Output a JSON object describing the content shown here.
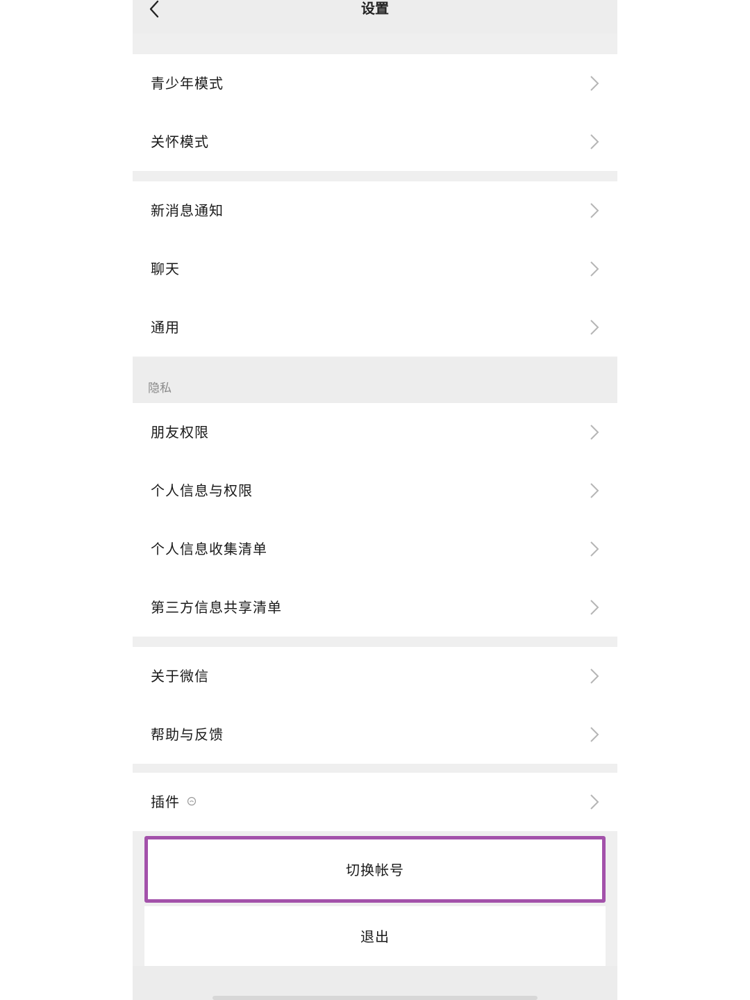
{
  "nav": {
    "title": "设置",
    "back_icon": "chevron-left-icon"
  },
  "groups": [
    {
      "items": [
        "青少年模式",
        "关怀模式"
      ]
    },
    {
      "items": [
        "新消息通知",
        "聊天",
        "通用"
      ]
    },
    {
      "header": "隐私",
      "items": [
        "朋友权限",
        "个人信息与权限",
        "个人信息收集清单",
        "第三方信息共享清单"
      ]
    },
    {
      "items": [
        "关于微信",
        "帮助与反馈"
      ]
    },
    {
      "items": [
        "插件"
      ]
    }
  ],
  "plugin_badge_icon": "plugin-badge-icon",
  "actions": {
    "switch_account": "切换帐号",
    "logout": "退出"
  },
  "colors": {
    "highlight_border": "#a352aa",
    "background": "#ededed",
    "row_background": "#ffffff",
    "chevron": "#b5b5b5"
  }
}
